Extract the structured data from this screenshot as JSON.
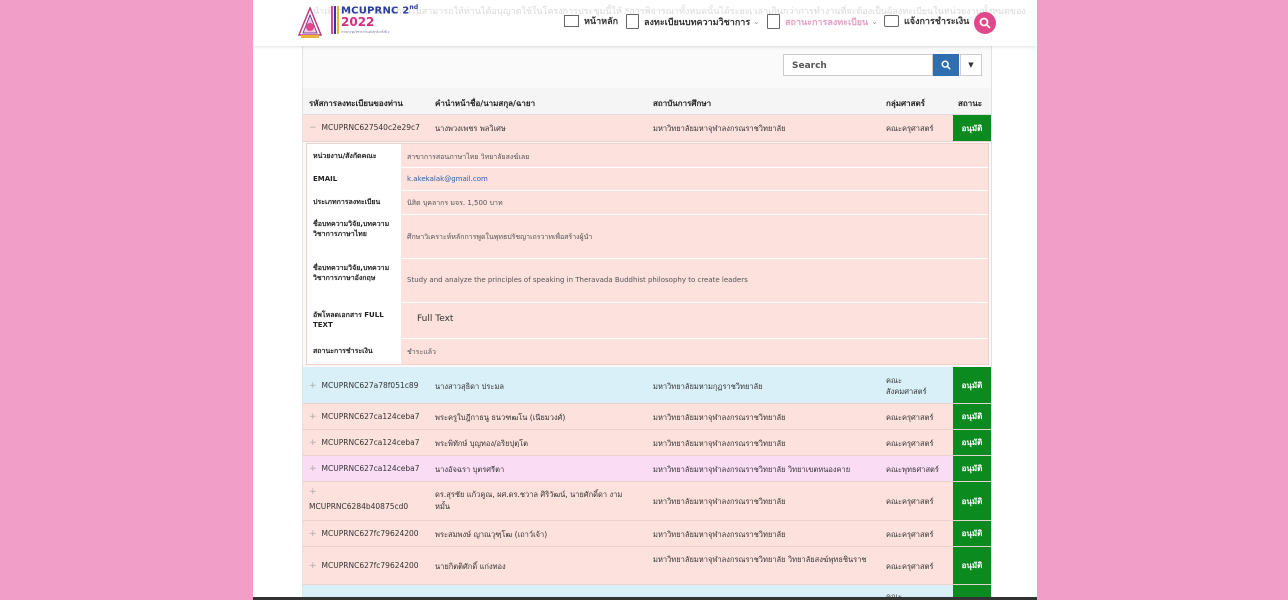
{
  "header": {
    "marquee": "นำเที่ยว กองบรรณาธิการไม่สามารถให้ท่านได้อนุญาตใช้ในโครงการประชุมนี้ให้ *การพิจารณาทั้งหมดนั้นได้ระยะเวลาเกินกว่าการทำงานที่จะต้องเป็นผู้ลงทะเบียนในหน่วยงานทั้งหมดของ",
    "logo_line1": "MCUPRNC 2",
    "logo_sup": "nd",
    "logo_line2": "2022",
    "logo_line3": "การประชุมวิชาการระดับชาติ ครั้งที่ 2",
    "nav": [
      {
        "label": "หน้าหลัก",
        "icon": "home-icon"
      },
      {
        "label": "ลงทะเบียนบทความวิชาการ",
        "icon": "document-icon",
        "has_dropdown": true
      },
      {
        "label": "สถานะการลงทะเบียน",
        "icon": "document-icon",
        "has_dropdown": true
      },
      {
        "label": "แจ้งการชำระเงิน",
        "icon": "payment-icon"
      }
    ],
    "search_icon": "search-icon"
  },
  "table": {
    "search_placeholder": "Search",
    "columns": [
      "รหัสการลงทะเบียนของท่าน",
      "คำนำหน้าชื่อ/นามสกุล/ฉายา",
      "สถาบันการศึกษา",
      "กลุ่มศาสตร์",
      "สถานะ"
    ],
    "expanded_row": {
      "id": "MCUPRNC627540c2e29c7",
      "name": "นางพวงเพชร พลวิเศษ",
      "institution": "มหาวิทยาลัยมหาจุฬาลงกรณราชวิทยาลัย",
      "faculty": "คณะครุศาสตร์",
      "status": "อนุมัติ",
      "toggle": "−"
    },
    "details": [
      {
        "label": "หน่วยงาน/สังกัดคณะ",
        "value": "สาขาการสอนภาษาไทย วิทยาลัยสงฆ์เลย"
      },
      {
        "label": "EMAIL",
        "value": "k.akekalak@gmail.com"
      },
      {
        "label": "ประเภทการลงทะเบียน",
        "value": "นิสิต บุคลากร มจร. 1,500 บาท"
      },
      {
        "label": "ชื่อบทความวิจัย,บทความวิชาการภาษาไทย",
        "value": "ศึกษาวิเคราะห์หลักการพูดในพุทธปรัชญาเถรวาทเพื่อสร้างผู้นำ"
      },
      {
        "label": "ชื่อบทความวิจัย,บทความวิชาการภาษาอังกฤษ",
        "value": "Study and analyze the principles of speaking in Theravada Buddhist philosophy to create leaders"
      },
      {
        "label": "อัพโหลดเอกสาร FULL TEXT",
        "value": "Full Text"
      },
      {
        "label": "สถานะการชำระเงิน",
        "value": "ชำระแล้ว"
      }
    ],
    "rows": [
      {
        "id": "MCUPRNC627a78f051c89",
        "name": "นางสาวสุธิดา ประมล",
        "institution": "มหาวิทยาลัยมหามกุฏราชวิทยาลัย",
        "faculty": "คณะ สังคมศาสตร์",
        "status": "อนุมัติ",
        "color": "#d9f0f8"
      },
      {
        "id": "MCUPRNC627ca124ceba7",
        "name": "พระครูใบฎีกาธนู ธนวฑฒโน (เนียมวงศ์)",
        "institution": "มหาวิทยาลัยมหาจุฬาลงกรณราชวิทยาลัย",
        "faculty": "คณะครุศาสตร์",
        "status": "อนุมัติ",
        "color": "#fce1dc"
      },
      {
        "id": "MCUPRNC627ca124ceba7",
        "name": "พระพิทักษ์ บุญทอง/อริยปุตฺโต",
        "institution": "มหาวิทยาลัยมหาจุฬาลงกรณราชวิทยาลัย",
        "faculty": "คณะครุศาสตร์",
        "status": "อนุมัติ",
        "color": "#fce1dc"
      },
      {
        "id": "MCUPRNC627ca124ceba7",
        "name": "นางอัจฉรา บุตรศรีตา",
        "institution": "มหาวิทยาลัยมหาจุฬาลงกรณราชวิทยาลัย วิทยาเขตหนองคาย",
        "faculty": "คณะพุทธศาสตร์",
        "status": "อนุมัติ",
        "color": "#fadcf5"
      },
      {
        "id": "MCUPRNC6284b40875cd0",
        "name": "ดร.สุรชัย แก้วคูณ, ผศ.ดร.ชวาล ศิริวัฒน์, นายศักดิ์ดา งามหมั้น",
        "institution": "มหาวิทยาลัยมหาจุฬาลงกรณราชวิทยาลัย",
        "faculty": "คณะครุศาสตร์",
        "status": "อนุมัติ",
        "color": "#fce1dc"
      },
      {
        "id": "MCUPRNC627fc79624200",
        "name": "พระสมพงษ์ ญาณวุฑฺโฒ (เถาว์เจ้า)",
        "institution": "มหาวิทยาลัยมหาจุฬาลงกรณราชวิทยาลัย",
        "faculty": "คณะครุศาสตร์",
        "status": "อนุมัติ",
        "color": "#fce1dc"
      },
      {
        "id": "MCUPRNC627fc79624200",
        "name": "นายกิตติศักดิ์ แก่งทอง",
        "institution": "มหาวิทยาลัยมหาจุฬาลงกรณราชวิทยาลัย วิทยาลัยสงฆ์พุทธชินราช",
        "faculty": "คณะครุศาสตร์",
        "status": "อนุมัติ",
        "color": "#fce1dc"
      }
    ],
    "row_toggle": "+",
    "partial_last_faculty": "คณะ"
  },
  "colors": {
    "accent": "#e0488b",
    "approved": "#0b8a1f",
    "background": "#f19ec9"
  }
}
